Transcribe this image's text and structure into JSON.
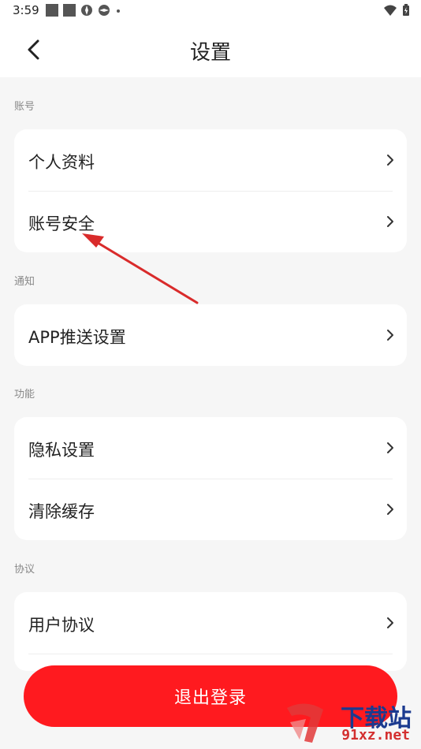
{
  "status_bar": {
    "time": "3:59"
  },
  "header": {
    "title": "设置"
  },
  "sections": [
    {
      "label": "账号",
      "items": [
        {
          "label": "个人资料"
        },
        {
          "label": "账号安全"
        }
      ]
    },
    {
      "label": "通知",
      "items": [
        {
          "label": "APP推送设置"
        }
      ]
    },
    {
      "label": "功能",
      "items": [
        {
          "label": "隐私设置"
        },
        {
          "label": "清除缓存"
        }
      ]
    },
    {
      "label": "协议",
      "items": [
        {
          "label": "用户协议"
        }
      ]
    }
  ],
  "logout_label": "退出登录",
  "watermark": {
    "brand": "下载站",
    "domain": "91xz.net"
  },
  "colors": {
    "accent": "#ff1a1f",
    "background": "#f6f6f6",
    "card": "#ffffff",
    "section_label": "#888888",
    "annotation_arrow": "#d92b2b"
  },
  "icons": {
    "back": "chevron-left-icon",
    "row_arrow": "chevron-right-icon"
  }
}
